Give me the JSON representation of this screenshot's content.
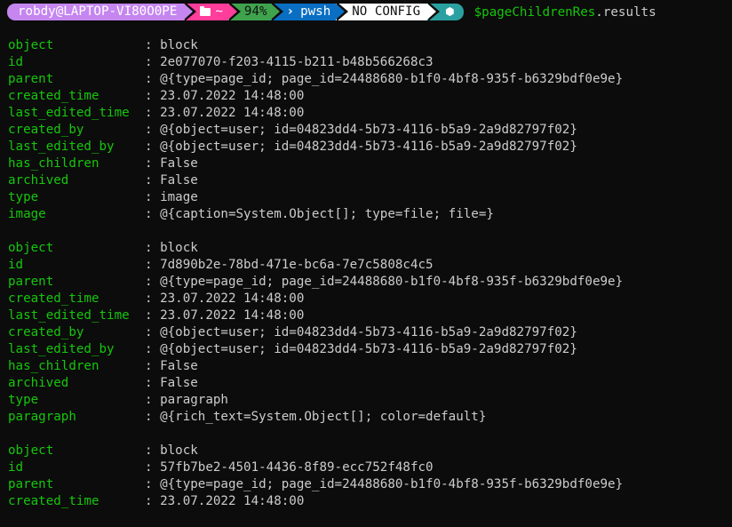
{
  "prompt": {
    "user_host": "robdy@LAPTOP-VI80O0PE",
    "path_icon": "folder-icon",
    "path": "~",
    "battery": "94%",
    "shell_icon": "terminal-prompt-icon",
    "shell": "pwsh",
    "config": "NO CONFIG",
    "node_icon": "nodejs-icon",
    "colors": {
      "user": "#c586f0",
      "path": "#ff3d9b",
      "battery": "#3fa34d",
      "shell": "#0a6fc2",
      "config": "#ffffff",
      "node": "#2aa0a0"
    },
    "command_variable": "$pageChildrenRes",
    "command_member": ".results"
  },
  "separator": ":",
  "records": [
    {
      "fields": [
        {
          "key": "object",
          "value": "block"
        },
        {
          "key": "id",
          "value": "2e077070-f203-4115-b211-b48b566268c3"
        },
        {
          "key": "parent",
          "value": "@{type=page_id; page_id=24488680-b1f0-4bf8-935f-b6329bdf0e9e}"
        },
        {
          "key": "created_time",
          "value": "23.07.2022 14:48:00"
        },
        {
          "key": "last_edited_time",
          "value": "23.07.2022 14:48:00"
        },
        {
          "key": "created_by",
          "value": "@{object=user; id=04823dd4-5b73-4116-b5a9-2a9d82797f02}"
        },
        {
          "key": "last_edited_by",
          "value": "@{object=user; id=04823dd4-5b73-4116-b5a9-2a9d82797f02}"
        },
        {
          "key": "has_children",
          "value": "False"
        },
        {
          "key": "archived",
          "value": "False"
        },
        {
          "key": "type",
          "value": "image"
        },
        {
          "key": "image",
          "value": "@{caption=System.Object[]; type=file; file=}"
        }
      ]
    },
    {
      "fields": [
        {
          "key": "object",
          "value": "block"
        },
        {
          "key": "id",
          "value": "7d890b2e-78bd-471e-bc6a-7e7c5808c4c5"
        },
        {
          "key": "parent",
          "value": "@{type=page_id; page_id=24488680-b1f0-4bf8-935f-b6329bdf0e9e}"
        },
        {
          "key": "created_time",
          "value": "23.07.2022 14:48:00"
        },
        {
          "key": "last_edited_time",
          "value": "23.07.2022 14:48:00"
        },
        {
          "key": "created_by",
          "value": "@{object=user; id=04823dd4-5b73-4116-b5a9-2a9d82797f02}"
        },
        {
          "key": "last_edited_by",
          "value": "@{object=user; id=04823dd4-5b73-4116-b5a9-2a9d82797f02}"
        },
        {
          "key": "has_children",
          "value": "False"
        },
        {
          "key": "archived",
          "value": "False"
        },
        {
          "key": "type",
          "value": "paragraph"
        },
        {
          "key": "paragraph",
          "value": "@{rich_text=System.Object[]; color=default}"
        }
      ]
    },
    {
      "fields": [
        {
          "key": "object",
          "value": "block"
        },
        {
          "key": "id",
          "value": "57fb7be2-4501-4436-8f89-ecc752f48fc0"
        },
        {
          "key": "parent",
          "value": "@{type=page_id; page_id=24488680-b1f0-4bf8-935f-b6329bdf0e9e}"
        },
        {
          "key": "created_time",
          "value": "23.07.2022 14:48:00"
        }
      ]
    }
  ]
}
